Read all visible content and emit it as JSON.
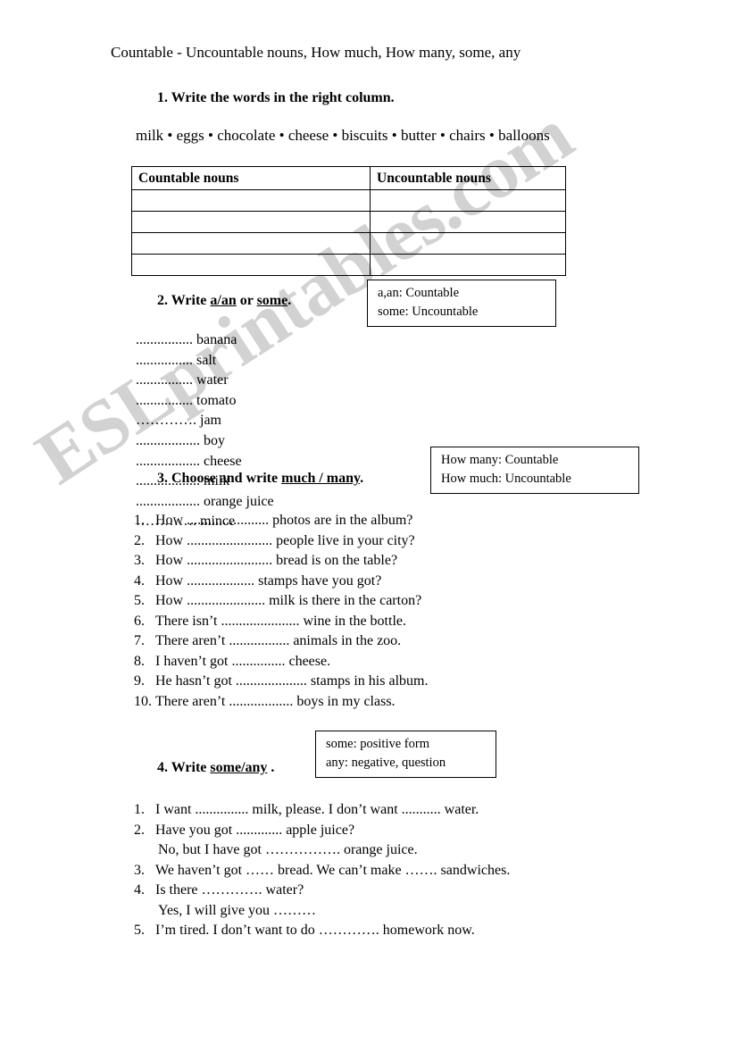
{
  "document": {
    "title": "Countable - Uncountable nouns, How much, How many, some, any",
    "watermark": "ESLprintables.com",
    "watermark_color": "#d2d2d2"
  },
  "section1": {
    "heading_number": "1.",
    "heading_text": "Write the words in the right column.",
    "word_bank": "milk • eggs • chocolate • cheese • biscuits • butter • chairs • balloons",
    "table": {
      "headers": [
        "Countable nouns",
        "Uncountable nouns"
      ],
      "rows": [
        [
          "",
          ""
        ],
        [
          "",
          ""
        ],
        [
          "",
          ""
        ],
        [
          "",
          ""
        ]
      ]
    }
  },
  "section2": {
    "heading_number": "2.",
    "heading_prefix": "Write ",
    "heading_option1": "a/an",
    "heading_middle": "  or ",
    "heading_option2": "some",
    "heading_suffix": ".",
    "hint": {
      "line1": "a,an:  Countable",
      "line2": "some: Uncountable"
    },
    "left_items": [
      "................ banana",
      "................ salt",
      "................ water",
      "................ tomato",
      "…………. jam"
    ],
    "right_items": [
      ".................. boy",
      ".................. cheese",
      ".................. milk",
      ".................. orange juice",
      "…………. mince"
    ]
  },
  "section3": {
    "heading_number": "3.",
    "heading_prefix": "Choose and write ",
    "heading_option": "much / many",
    "heading_suffix": ".",
    "hint": {
      "line1": "How many:  Countable",
      "line2": "How much: Uncountable"
    },
    "items": [
      {
        "num": "1.",
        "text": "How ....................... photos are in the album?"
      },
      {
        "num": "2.",
        "text": "How ........................ people live in your city?"
      },
      {
        "num": "3.",
        "text": "How ........................ bread is on the table?"
      },
      {
        "num": "4.",
        "text": "How ................... stamps have you got?"
      },
      {
        "num": "5.",
        "text": "How ...................... milk is there in the carton?"
      },
      {
        "num": "6.",
        "text": "There isn’t ...................... wine in the bottle."
      },
      {
        "num": "7.",
        "text": "There aren’t ................. animals in the zoo."
      },
      {
        "num": "8.",
        "text": "I haven’t got ............... cheese."
      },
      {
        "num": "9.",
        "text": "He hasn’t got .................... stamps in his album."
      },
      {
        "num": "10.",
        "text": "There aren’t .................. boys in my class."
      }
    ]
  },
  "section4": {
    "heading_number": "4.",
    "heading_prefix": "Write ",
    "heading_option": "some/any",
    "heading_suffix": " .",
    "hint": {
      "line1": "some: positive form",
      "line2": "any: negative, question"
    },
    "items": [
      {
        "num": "1.",
        "text": "I want ............... milk, please. I don’t want ........... water.",
        "cont": ""
      },
      {
        "num": "2.",
        "text": "Have you got ............. apple juice?",
        "cont": "No, but I have got ……………. orange juice."
      },
      {
        "num": "3.",
        "text": "We haven’t got …… bread. We can’t make ……. sandwiches.",
        "cont": ""
      },
      {
        "num": "4.",
        "text": "Is there …………. water?",
        "cont": "Yes, I will give you ………"
      },
      {
        "num": "5.",
        "text": "I’m tired. I don’t want to do …………. homework now.",
        "cont": ""
      }
    ]
  }
}
